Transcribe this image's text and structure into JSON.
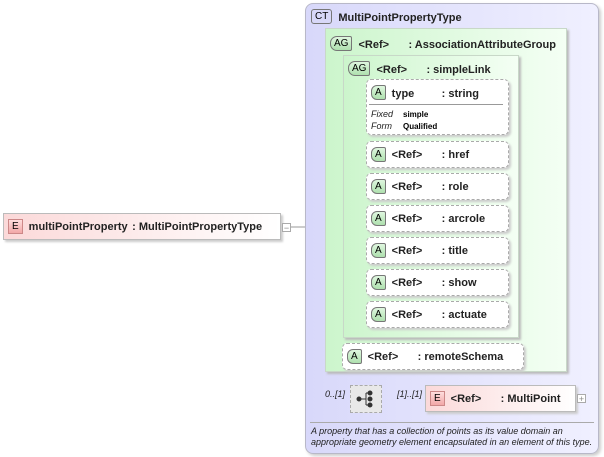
{
  "element": {
    "name": "multiPointProperty",
    "type": ": MultiPointPropertyType",
    "badge": "E",
    "toggle": "−"
  },
  "complex_type": {
    "badge": "CT",
    "name": "MultiPointPropertyType"
  },
  "association_group": {
    "badge": "AG",
    "ref": "<Ref>",
    "name": ": AssociationAttributeGroup"
  },
  "simple_link": {
    "badge": "AG",
    "ref": "<Ref>",
    "name": ": simpleLink"
  },
  "type_attr": {
    "badge": "A",
    "name": "type",
    "type": ": string",
    "fixed_label": "Fixed",
    "fixed_value": "simple",
    "form_label": "Form",
    "form_value": "Qualified"
  },
  "attributes": [
    {
      "badge": "A",
      "ref": "<Ref>",
      "name": ": href"
    },
    {
      "badge": "A",
      "ref": "<Ref>",
      "name": ": role"
    },
    {
      "badge": "A",
      "ref": "<Ref>",
      "name": ": arcrole"
    },
    {
      "badge": "A",
      "ref": "<Ref>",
      "name": ": title"
    },
    {
      "badge": "A",
      "ref": "<Ref>",
      "name": ": show"
    },
    {
      "badge": "A",
      "ref": "<Ref>",
      "name": ": actuate"
    }
  ],
  "remote_schema": {
    "badge": "A",
    "ref": "<Ref>",
    "name": ": remoteSchema"
  },
  "sequence": {
    "occurs": "0..[1]",
    "child_occurs": "[1]..[1]",
    "icon": "sequence-icon"
  },
  "multipoint": {
    "badge": "E",
    "ref": "<Ref>",
    "name": ": MultiPoint",
    "toggle": "+"
  },
  "description": "A property that has a collection of points as its value domain an appropriate geometry element encapsulated in an element of this type."
}
